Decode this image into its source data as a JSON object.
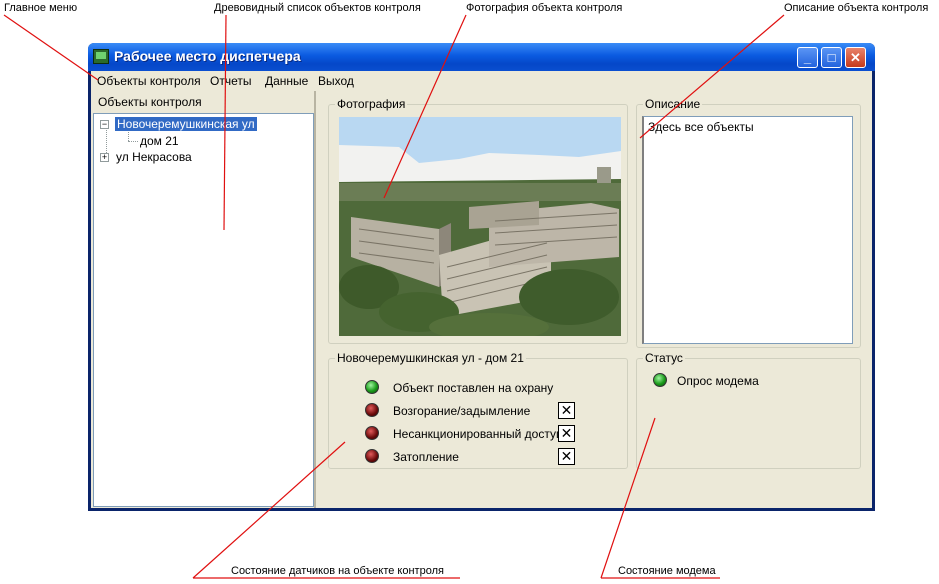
{
  "callouts": {
    "main_menu": "Главное меню",
    "tree": "Древовидный список объектов контроля",
    "photo": "Фотография объекта контроля",
    "description": "Описание объекта контроля",
    "sensors": "Состояние датчиков на объекте контроля",
    "modem": "Состояние модема"
  },
  "window": {
    "title": "Рабочее место диспетчера",
    "controls": {
      "minimize": "_",
      "maximize": "□",
      "close": "✕"
    }
  },
  "menu": {
    "items": [
      "Объекты контроля",
      "Отчеты",
      "Данные",
      "Выход"
    ]
  },
  "sidebar": {
    "header": "Объекты контроля",
    "tree": [
      {
        "label": "Новочеремушкинская ул",
        "expander": "−",
        "selected": true
      },
      {
        "label": "дом 21",
        "child": true
      },
      {
        "label": "ул Некрасова",
        "expander": "+"
      }
    ]
  },
  "photo_group": {
    "label": "Фотография",
    "image": "apartment-buildings-aerial-photo"
  },
  "description_group": {
    "label": "Описание",
    "text": "Здесь все объекты"
  },
  "sensors_group": {
    "label": "Новочеремушкинская ул - дом 21",
    "items": [
      {
        "label": "Объект поставлен на охрану",
        "led": "green",
        "has_close": false
      },
      {
        "label": "Возгорание/задымление",
        "led": "red",
        "has_close": true
      },
      {
        "label": "Несанкционированный доступ",
        "led": "red",
        "has_close": true
      },
      {
        "label": "Затопление",
        "led": "red",
        "has_close": true
      }
    ],
    "close_glyph": "✕"
  },
  "status_group": {
    "label": "Статус",
    "modem_label": "Опрос модема",
    "modem_led": "green"
  },
  "colors": {
    "title_bar": "#0a5ae0",
    "window_bg": "#ece9d8",
    "selection": "#316ac5",
    "led_on": "#1a9a1a",
    "led_off": "#6a0a0a"
  }
}
